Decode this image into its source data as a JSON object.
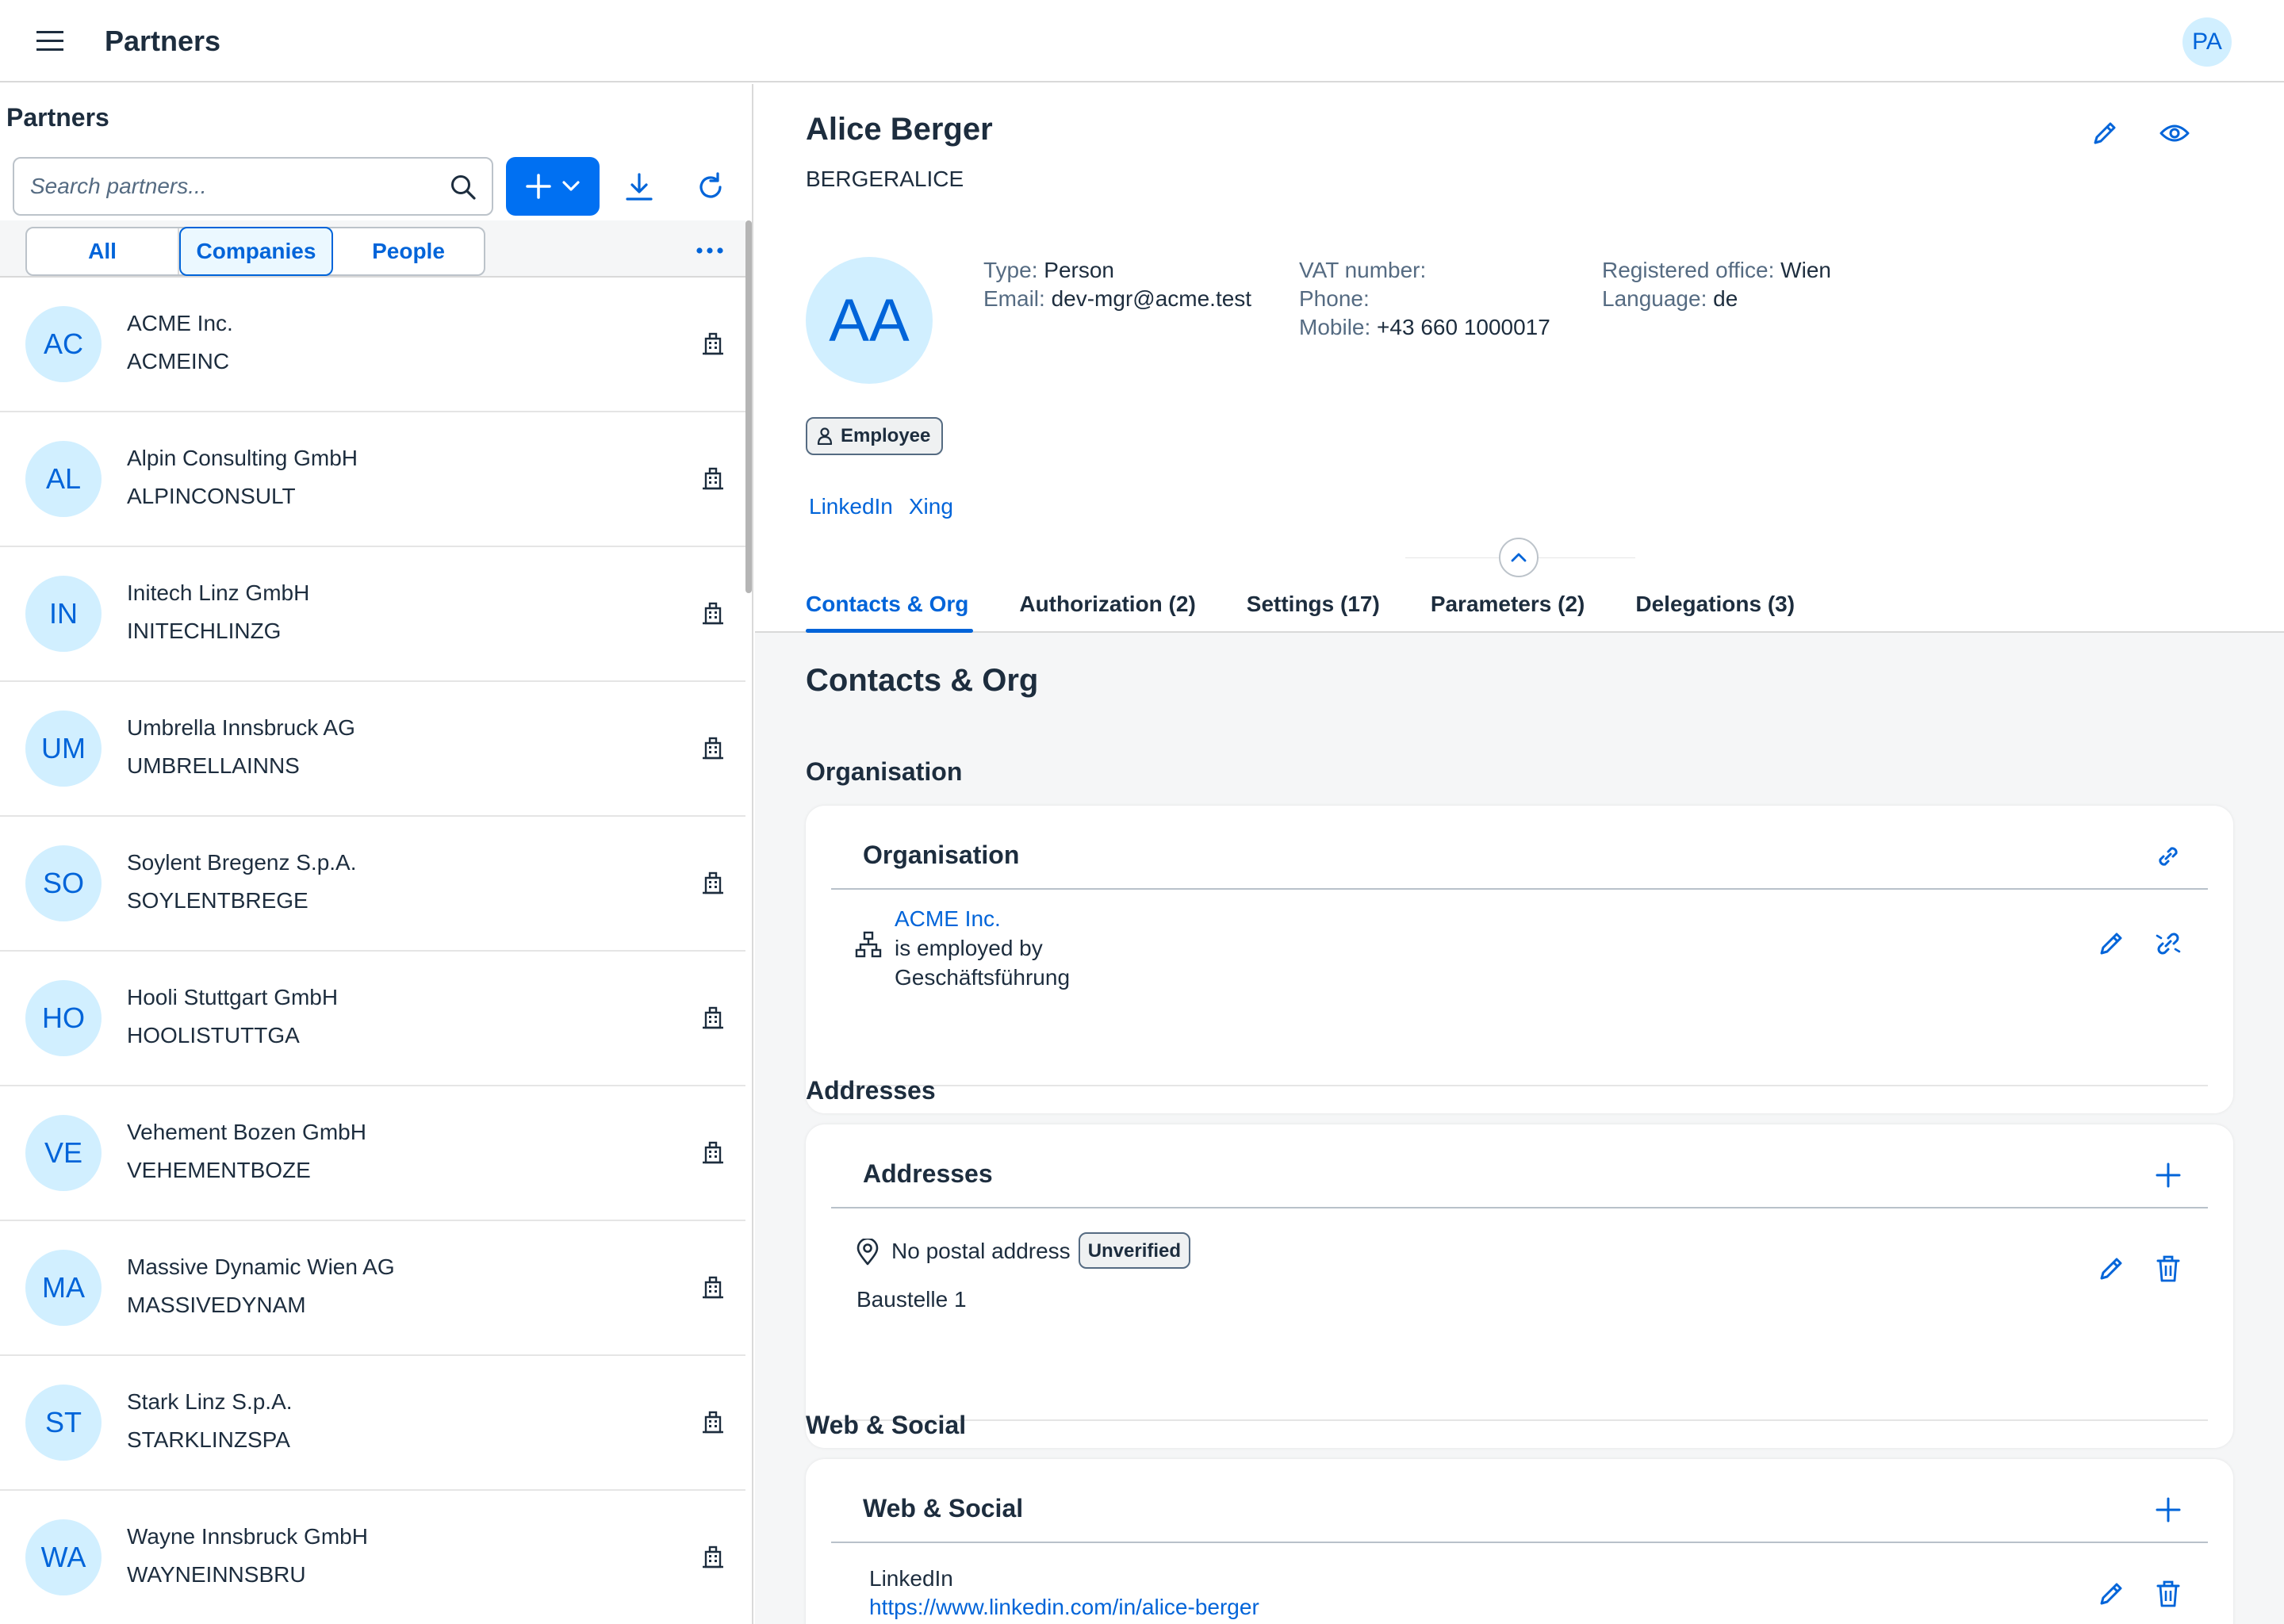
{
  "shell": {
    "title": "Partners",
    "user_initials": "PA"
  },
  "list_pane": {
    "title": "Partners",
    "search_placeholder": "Search partners...",
    "filters": [
      {
        "label": "All"
      },
      {
        "label": "Companies",
        "selected": true
      },
      {
        "label": "People"
      }
    ],
    "items": [
      {
        "initials": "AC",
        "name": "ACME Inc.",
        "code": "ACMEINC"
      },
      {
        "initials": "AL",
        "name": "Alpin Consulting GmbH",
        "code": "ALPINCONSULT"
      },
      {
        "initials": "IN",
        "name": "Initech Linz GmbH",
        "code": "INITECHLINZG"
      },
      {
        "initials": "UM",
        "name": "Umbrella Innsbruck AG",
        "code": "UMBRELLAINNS"
      },
      {
        "initials": "SO",
        "name": "Soylent Bregenz S.p.A.",
        "code": "SOYLENTBREGE"
      },
      {
        "initials": "HO",
        "name": "Hooli Stuttgart GmbH",
        "code": "HOOLISTUTTGA"
      },
      {
        "initials": "VE",
        "name": "Vehement Bozen GmbH",
        "code": "VEHEMENTBOZE"
      },
      {
        "initials": "MA",
        "name": "Massive Dynamic Wien AG",
        "code": "MASSIVEDYNAM"
      },
      {
        "initials": "ST",
        "name": "Stark Linz S.p.A.",
        "code": "STARKLINZSPA"
      },
      {
        "initials": "WA",
        "name": "Wayne Innsbruck GmbH",
        "code": "WAYNEINNSBRU"
      }
    ]
  },
  "detail": {
    "name": "Alice Berger",
    "code": "BERGERALICE",
    "initials": "AA",
    "attributes": {
      "type_label": "Type:",
      "type_value": "Person",
      "email_label": "Email:",
      "email_value": "dev-mgr@acme.test",
      "vat_label": "VAT number:",
      "vat_value": "",
      "phone_label": "Phone:",
      "phone_value": "",
      "mobile_label": "Mobile:",
      "mobile_value": "+43 660 1000017",
      "office_label": "Registered office:",
      "office_value": "Wien",
      "language_label": "Language:",
      "language_value": "de"
    },
    "role_tag": "Employee",
    "social_links": [
      "LinkedIn",
      "Xing"
    ],
    "tabs": [
      {
        "label": "Contacts & Org",
        "active": true
      },
      {
        "label": "Authorization (2)"
      },
      {
        "label": "Settings (17)"
      },
      {
        "label": "Parameters (2)"
      },
      {
        "label": "Delegations (3)"
      }
    ],
    "section_title": "Contacts & Org",
    "organisation": {
      "group_title": "Organisation",
      "card_title": "Organisation",
      "org_name": "ACME Inc.",
      "relation": "is employed by",
      "unit": "Geschäftsführung"
    },
    "addresses": {
      "group_title": "Addresses",
      "card_title": "Addresses",
      "address_title": "No postal address",
      "status": "Unverified",
      "line": "Baustelle 1"
    },
    "web_social": {
      "group_title": "Web & Social",
      "card_title": "Web & Social",
      "entry_label": "LinkedIn",
      "entry_url": "https://www.linkedin.com/in/alice-berger"
    }
  },
  "colors": {
    "accent": "#0064d9",
    "button": "#0070f2",
    "avatar_bg": "#d1efff",
    "text": "#1d2d3e",
    "muted": "#556b82"
  }
}
